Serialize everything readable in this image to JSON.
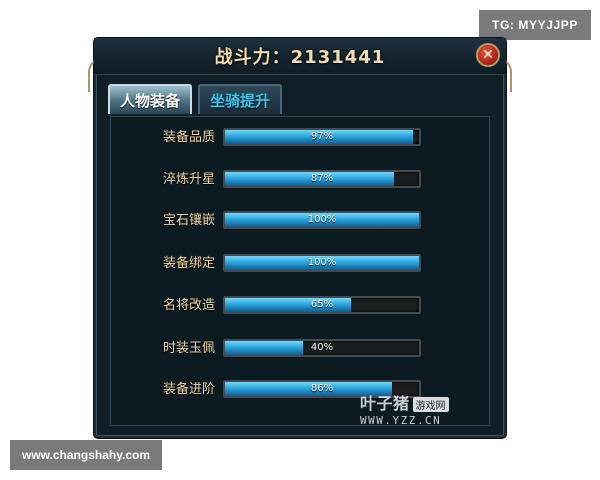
{
  "overlay": {
    "tg_label": "TG: MYYJJPP",
    "site_label": "www.changshahy.com"
  },
  "panel": {
    "title": "战斗力：2131441",
    "close_glyph": "✕"
  },
  "tabs": [
    {
      "label": "人物装备",
      "active": true
    },
    {
      "label": "坐骑提升",
      "active": false
    }
  ],
  "stats": [
    {
      "label": "装备品质",
      "percent_text": "97%",
      "value": 97
    },
    {
      "label": "淬炼升星",
      "percent_text": "87%",
      "value": 87
    },
    {
      "label": "宝石镶嵌",
      "percent_text": "100%",
      "value": 100
    },
    {
      "label": "装备绑定",
      "percent_text": "100%",
      "value": 100
    },
    {
      "label": "名将改造",
      "percent_text": "65%",
      "value": 65
    },
    {
      "label": "时装玉佩",
      "percent_text": "40%",
      "value": 40
    },
    {
      "label": "装备进阶",
      "percent_text": "86%",
      "value": 86
    }
  ],
  "watermark": {
    "brand": "叶子猪",
    "tag": "游戏网",
    "url": "WWW.YZZ.CN"
  },
  "colors": {
    "bar_fill": "#2aa6de",
    "label_gold": "#f0d6a4",
    "tab_inactive_text": "#3fc6f0"
  }
}
